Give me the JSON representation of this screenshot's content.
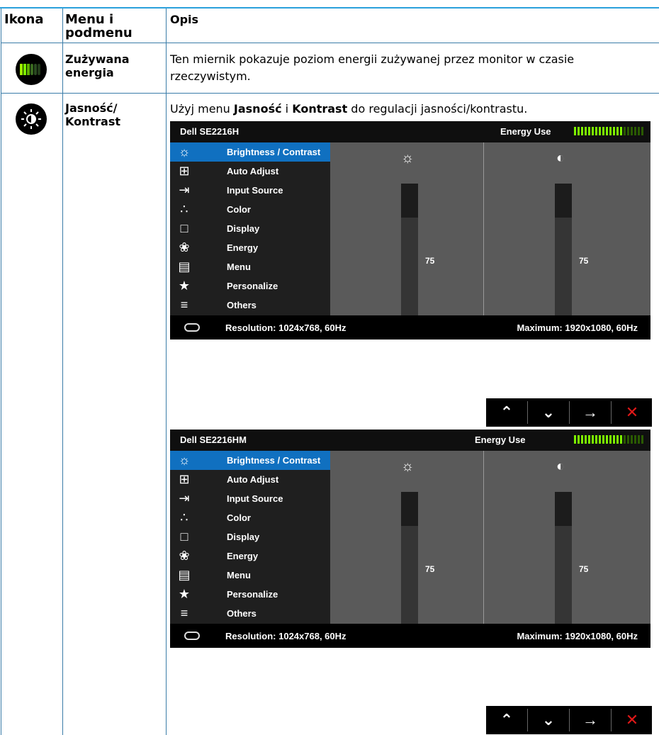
{
  "table": {
    "headers": {
      "icon": "Ikona",
      "menu": "Menu i podmenu",
      "description": "Opis"
    },
    "rows": [
      {
        "icon": "energy-meter-icon",
        "menu": "Zużywana energia",
        "description": "Ten miernik pokazuje poziom energii zużywanej przez monitor w czasie rzeczywistym."
      },
      {
        "icon": "brightness-icon",
        "menu": "Jasność/ Kontrast",
        "description": {
          "p1": "Użyj menu ",
          "b1": "Jasność",
          "p2": " i ",
          "b2": "Kontrast",
          "p3": " do regulacji jasności/kontrastu."
        }
      }
    ]
  },
  "osd_screens": [
    {
      "model": "Dell SE2216H",
      "energy_label": "Energy Use",
      "menu_items": [
        {
          "label": "Brightness / Contrast",
          "icon": "brightness-icon",
          "selected": true
        },
        {
          "label": "Auto Adjust",
          "icon": "auto-adjust-icon"
        },
        {
          "label": "Input Source",
          "icon": "input-source-icon"
        },
        {
          "label": "Color",
          "icon": "color-icon"
        },
        {
          "label": "Display",
          "icon": "display-icon"
        },
        {
          "label": "Energy",
          "icon": "energy-icon"
        },
        {
          "label": "Menu",
          "icon": "menu-icon"
        },
        {
          "label": "Personalize",
          "icon": "star-icon"
        },
        {
          "label": "Others",
          "icon": "others-icon"
        }
      ],
      "brightness_value": "75",
      "contrast_value": "75",
      "resolution": "Resolution: 1024x768, 60Hz",
      "maximum": "Maximum: 1920x1080, 60Hz"
    },
    {
      "model": "Dell SE2216HM",
      "energy_label": "Energy Use",
      "menu_items": [
        {
          "label": "Brightness / Contrast",
          "icon": "brightness-icon",
          "selected": true
        },
        {
          "label": "Auto Adjust",
          "icon": "auto-adjust-icon"
        },
        {
          "label": "Input Source",
          "icon": "input-source-icon"
        },
        {
          "label": "Color",
          "icon": "color-icon"
        },
        {
          "label": "Display",
          "icon": "display-icon"
        },
        {
          "label": "Energy",
          "icon": "energy-icon"
        },
        {
          "label": "Menu",
          "icon": "menu-icon"
        },
        {
          "label": "Personalize",
          "icon": "star-icon"
        },
        {
          "label": "Others",
          "icon": "others-icon"
        }
      ],
      "brightness_value": "75",
      "contrast_value": "75",
      "resolution": "Resolution: 1024x768,  60Hz",
      "maximum": "Maximum: 1920x1080,  60Hz"
    }
  ],
  "nav_buttons": [
    "up-arrow-icon",
    "down-arrow-icon",
    "right-arrow-icon",
    "close-icon"
  ],
  "colors": {
    "table_line": "#3a7ca8",
    "top_rule": "#2aa0dc",
    "osd_selected": "#1070c0",
    "meter_on": "#7cf000",
    "close": "#e01818"
  }
}
